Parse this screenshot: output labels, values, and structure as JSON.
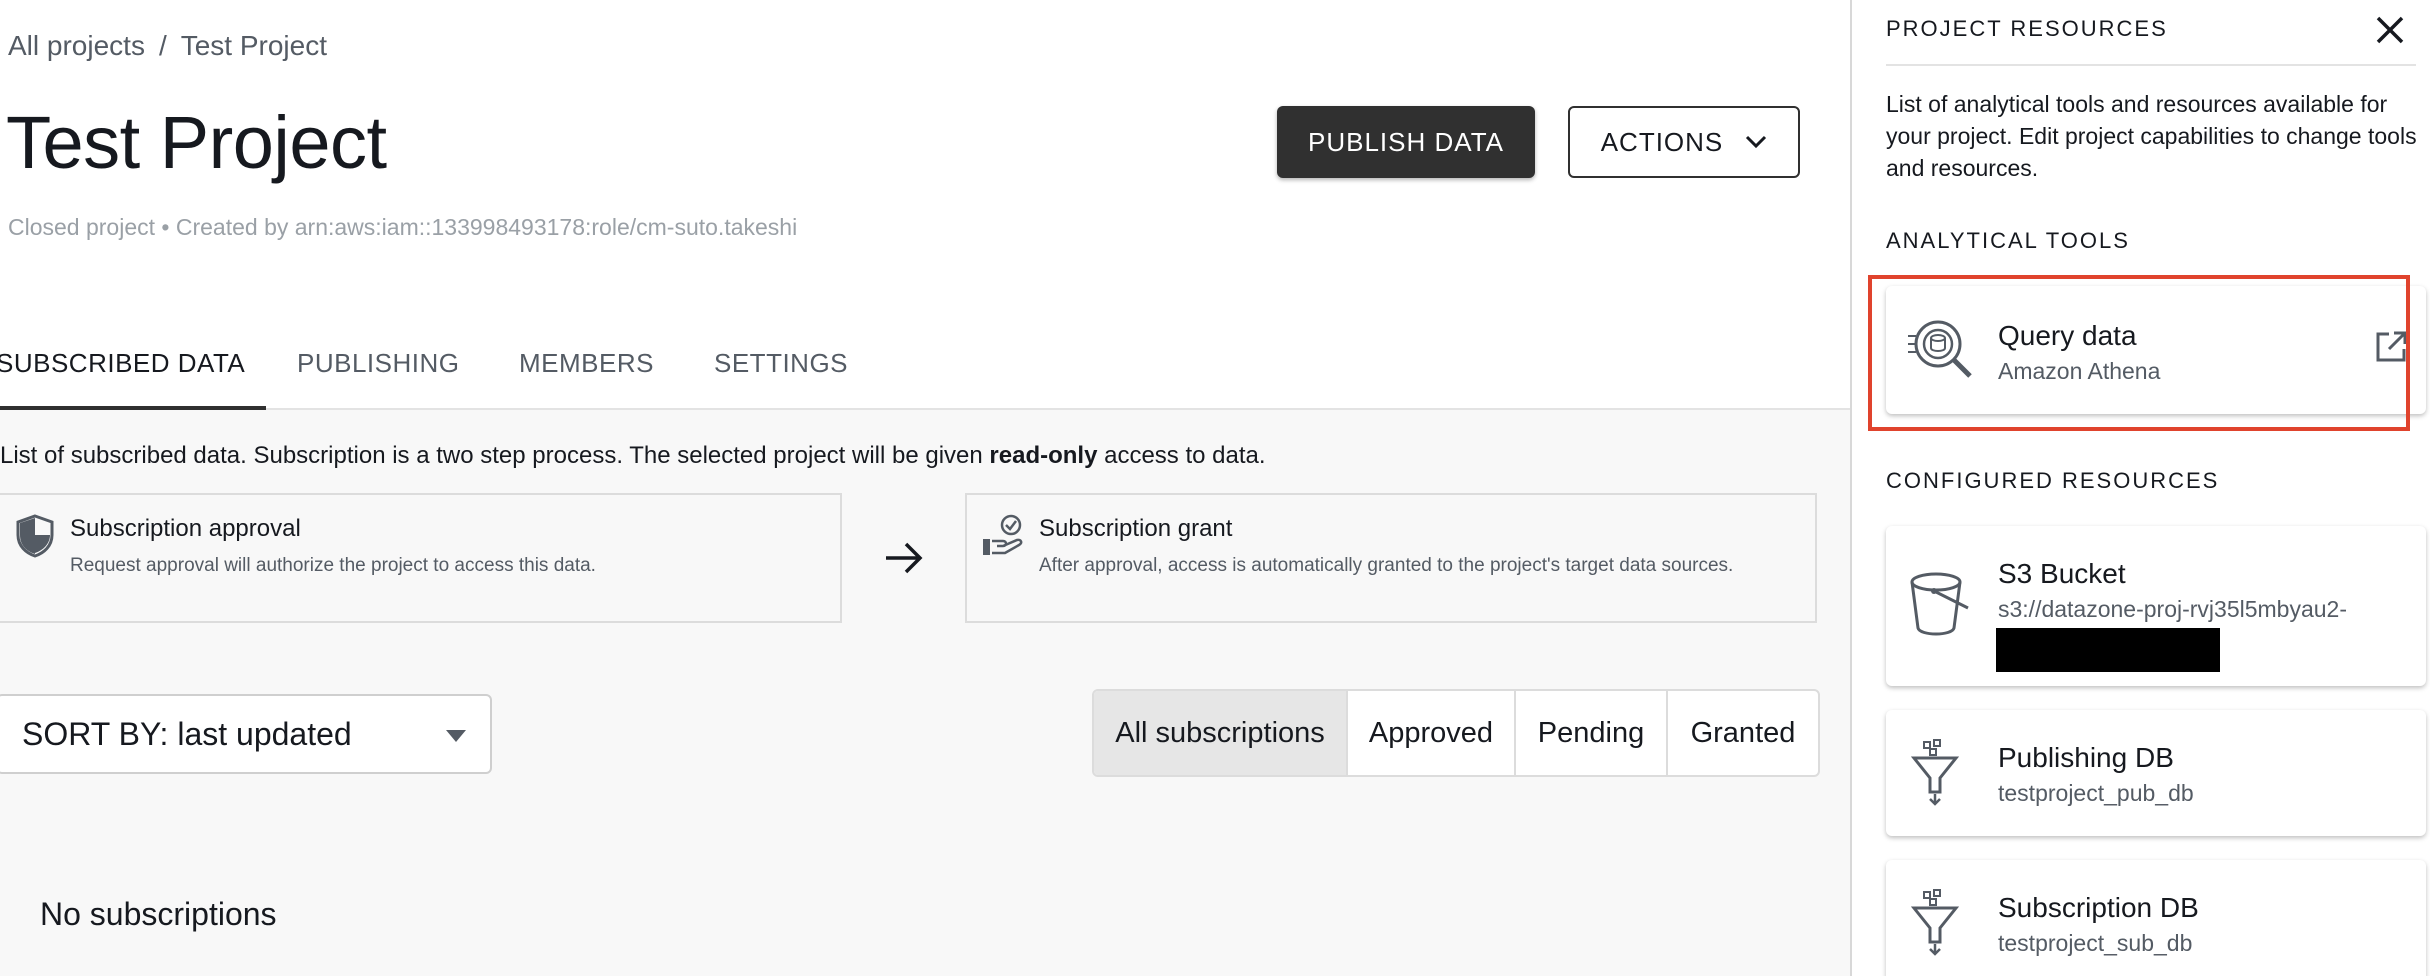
{
  "breadcrumb": {
    "root": "All projects",
    "separator": "/",
    "current": "Test Project"
  },
  "header": {
    "title": "Test Project",
    "meta": "Closed project • Created by arn:aws:iam::133998493178:role/cm-suto.takeshi",
    "publish_label": "PUBLISH DATA",
    "actions_label": "ACTIONS"
  },
  "tabs": [
    {
      "label": "SUBSCRIBED DATA",
      "active": true
    },
    {
      "label": "PUBLISHING",
      "active": false
    },
    {
      "label": "MEMBERS",
      "active": false
    },
    {
      "label": "SETTINGS",
      "active": false
    }
  ],
  "subscribed": {
    "desc_before": "List of subscribed data. Subscription is a two step process. The selected project will be given ",
    "desc_bold": "read-only",
    "desc_after": " access to data.",
    "approval": {
      "title": "Subscription approval",
      "text": "Request approval will authorize the project to access this data.",
      "icon": "shield-icon"
    },
    "grant": {
      "title": "Subscription grant",
      "text": "After approval, access is automatically granted to the project's target data sources.",
      "icon": "hand-check-icon"
    },
    "sort_label": "SORT BY: last updated",
    "filters": [
      {
        "label": "All subscriptions",
        "active": true
      },
      {
        "label": "Approved",
        "active": false
      },
      {
        "label": "Pending",
        "active": false
      },
      {
        "label": "Granted",
        "active": false
      }
    ],
    "empty_text": "No subscriptions"
  },
  "panel": {
    "title": "PROJECT RESOURCES",
    "description": "List of analytical tools and resources available for your project. Edit project capabilities to change tools and resources.",
    "analytical_heading": "ANALYTICAL TOOLS",
    "tool": {
      "title": "Query data",
      "subtitle": "Amazon Athena",
      "icon": "query-data-icon"
    },
    "configured_heading": "CONFIGURED RESOURCES",
    "resources": [
      {
        "title": "S3 Bucket",
        "subtitle": "s3://datazone-proj-rvj35l5mbyau2-",
        "icon": "bucket-icon"
      },
      {
        "title": "Publishing DB",
        "subtitle": "testproject_pub_db",
        "icon": "funnel-icon"
      },
      {
        "title": "Subscription DB",
        "subtitle": "testproject_sub_db",
        "icon": "funnel-icon"
      }
    ]
  },
  "colors": {
    "primary_button": "#303030",
    "highlight": "#e0432d",
    "text": "#16191f",
    "muted": "#545b64"
  }
}
